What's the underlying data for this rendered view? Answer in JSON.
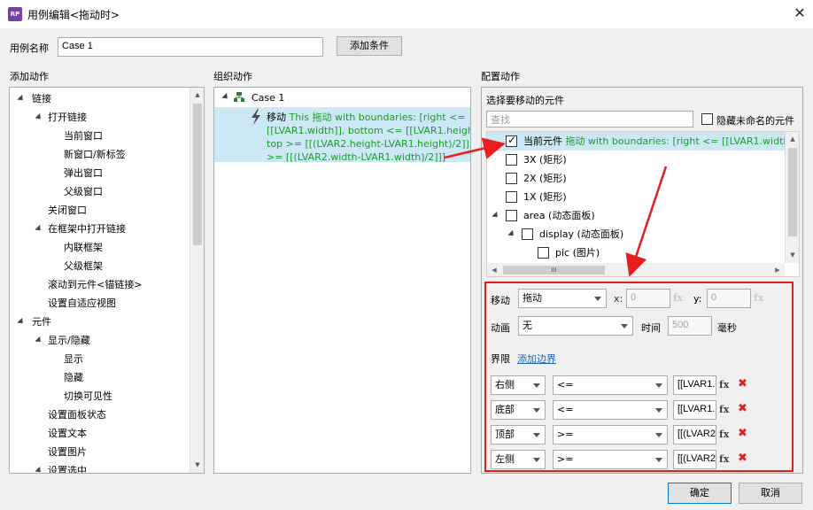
{
  "window": {
    "title": "用例编辑<拖动时>",
    "icon_text": "RP",
    "close": "✕"
  },
  "case_name": {
    "label": "用例名称",
    "value": "Case 1",
    "add_condition": "添加条件"
  },
  "add_actions": {
    "header": "添加动作",
    "items": [
      {
        "label": "链接"
      },
      {
        "label": "打开链接"
      },
      {
        "label": "当前窗口"
      },
      {
        "label": "新窗口/新标签"
      },
      {
        "label": "弹出窗口"
      },
      {
        "label": "父级窗口"
      },
      {
        "label": "关闭窗口"
      },
      {
        "label": "在框架中打开链接"
      },
      {
        "label": "内联框架"
      },
      {
        "label": "父级框架"
      },
      {
        "label": "滚动到元件<锚链接>"
      },
      {
        "label": "设置自适应视图"
      },
      {
        "label": "元件"
      },
      {
        "label": "显示/隐藏"
      },
      {
        "label": "显示"
      },
      {
        "label": "隐藏"
      },
      {
        "label": "切换可见性"
      },
      {
        "label": "设置面板状态"
      },
      {
        "label": "设置文本"
      },
      {
        "label": "设置图片"
      },
      {
        "label": "设置选中"
      }
    ]
  },
  "organize": {
    "header": "组织动作",
    "case_label": "Case 1",
    "action_verb": "移动",
    "action_line1": "This 拖动 with boundaries: [right <=",
    "action_line2": "[[LVAR1.width]], bottom <= [[LVAR1.height]],",
    "action_line3": "top >= [[(LVAR2.height-LVAR1.height)/2]], left",
    "action_line4": ">= [[(LVAR2.width-LVAR1.width)/2]]]"
  },
  "config": {
    "header": "配置动作",
    "select_label": "选择要移动的元件",
    "search_placeholder": "查找",
    "hide_unnamed": "隐藏未命名的元件",
    "widgets": [
      {
        "name": "当前元件",
        "detail": "拖动 with boundaries: [right <= [[LVAR1.width]], bott",
        "checked": true
      },
      {
        "name": "3X (矩形)",
        "checked": false
      },
      {
        "name": "2X (矩形)",
        "checked": false
      },
      {
        "name": "1X (矩形)",
        "checked": false
      },
      {
        "name": "area (动态面板)",
        "checked": false
      },
      {
        "name": "display (动态面板)",
        "checked": false
      },
      {
        "name": "pic (图片)",
        "checked": false
      }
    ],
    "hscroll_grip": "III",
    "move_label": "移动",
    "move_value": "拖动",
    "x_label": "x:",
    "x_value": "0",
    "y_label": "y:",
    "y_value": "0",
    "fx": "fx",
    "anim_label": "动画",
    "anim_value": "无",
    "time_label": "时间",
    "time_value": "500",
    "ms_label": "毫秒",
    "bounds_label": "界限",
    "add_bound": "添加边界",
    "bounds": [
      {
        "side": "右侧",
        "op": "<=",
        "value": "[[LVAR1."
      },
      {
        "side": "底部",
        "op": "<=",
        "value": "[[LVAR1."
      },
      {
        "side": "顶部",
        "op": ">=",
        "value": "[[(LVAR2"
      },
      {
        "side": "左侧",
        "op": ">=",
        "value": "[[(LVAR2"
      }
    ],
    "delete": "✖"
  },
  "buttons": {
    "ok": "确定",
    "cancel": "取消"
  },
  "colors": {
    "selection": "#cce8f4",
    "highlight": "#e81e1e",
    "link": "#1a66b3",
    "green": "#1e9a2e"
  }
}
